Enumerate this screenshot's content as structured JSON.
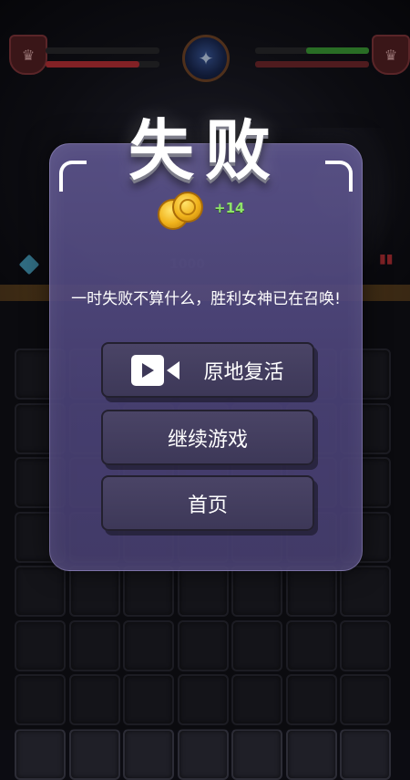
{
  "title": "失败",
  "reward": {
    "icon": "gold-coins-icon",
    "amount": "+14"
  },
  "message": "一时失败不算什么，胜利女神已在召唤!",
  "buttons": {
    "revive": {
      "label": "原地复活",
      "icon": "video-camera-icon"
    },
    "continue": {
      "label": "继续游戏"
    },
    "home": {
      "label": "首页"
    }
  },
  "background": {
    "dim_score": "1000",
    "hp_bars": {
      "player": 0.82,
      "enemy": 0.55
    }
  },
  "colors": {
    "dialog": "#5a528a",
    "button": "#443f60",
    "reward_text": "#8fe36a",
    "coin": "#f0b21a"
  }
}
